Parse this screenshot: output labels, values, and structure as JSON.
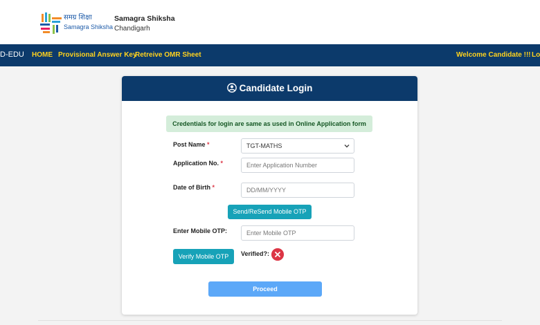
{
  "header": {
    "logo_hindi": "समग्र शिक्षा",
    "logo_english": "Samagra Shiksha",
    "org_name": "Samagra Shiksha",
    "org_city": "Chandigarh"
  },
  "navbar": {
    "brand": "D-EDU",
    "links": [
      "HOME",
      "Provisional Answer Key",
      "Retreive OMR Sheet"
    ],
    "welcome": "Welcome Candidate !!!",
    "logout_partial": "Log"
  },
  "card": {
    "title": "Candidate Login",
    "notice": "Credentials for login are same as used in Online Application form"
  },
  "form": {
    "post_name_label": "Post Name",
    "post_name_value": "TGT-MATHS",
    "app_no_label": "Application No.",
    "app_no_placeholder": "Enter Application Number",
    "dob_label": "Date of Birth",
    "dob_placeholder": "DD/MM/YYYY",
    "send_otp_button": "Send/ReSend Mobile OTP",
    "otp_label": "Enter Mobile OTP:",
    "otp_placeholder": "Enter Mobile OTP",
    "verify_button": "Verify Mobile OTP",
    "verified_label": "Verified?:",
    "proceed_button": "Proceed",
    "required_mark": "*"
  },
  "colors": {
    "navbar": "#0c3a6b",
    "nav_link": "#ffd21e",
    "teal_button": "#17a2b8",
    "proceed_button": "#5ca8f8",
    "error": "#dc3545",
    "notice_bg": "#d4edda"
  }
}
